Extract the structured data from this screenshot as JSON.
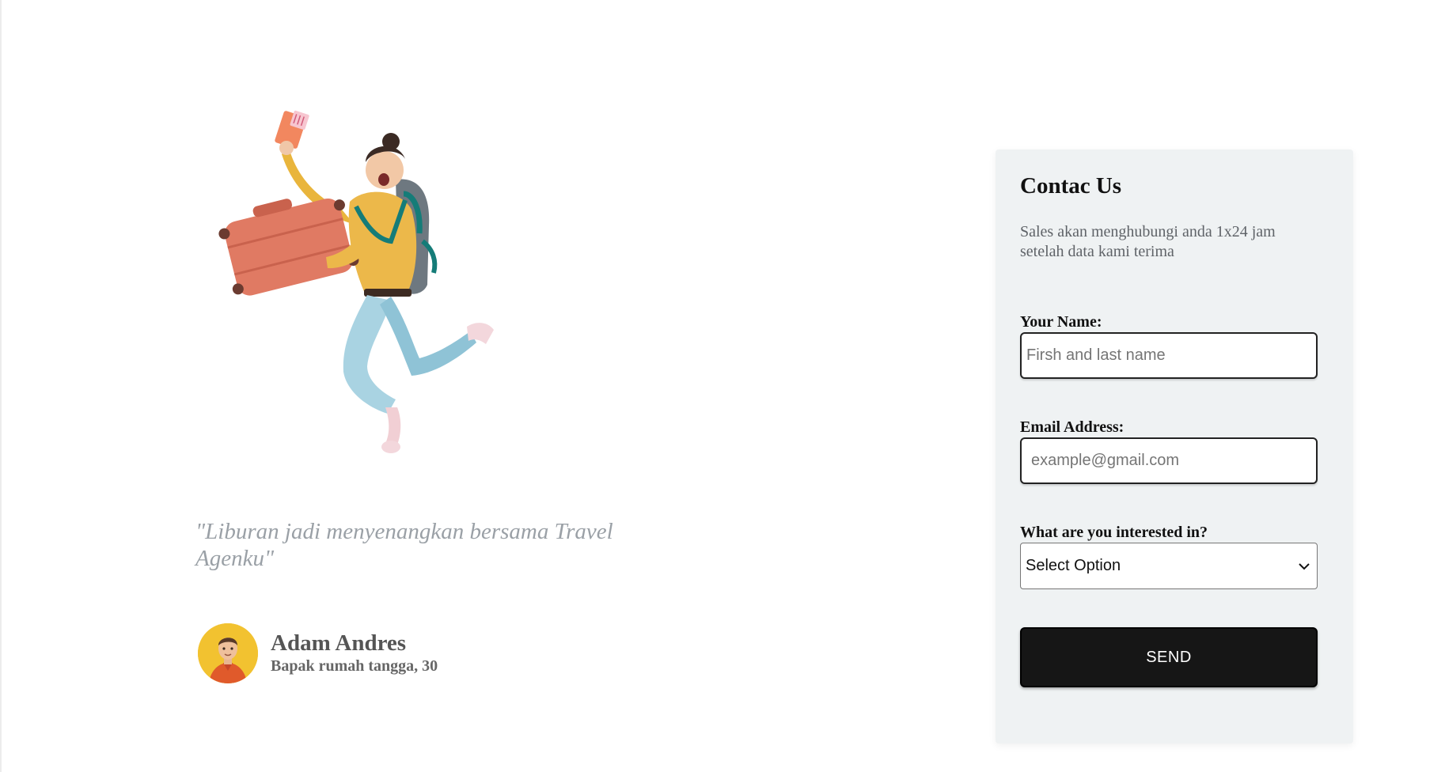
{
  "hero": {
    "illustration_icon": "jumping-traveler-illustration",
    "quote": "\"Liburan jadi menyenangkan bersama Travel Agenku\""
  },
  "testimonial": {
    "avatar_icon": "avatar-portrait",
    "name": "Adam Andres",
    "role": "Bapak rumah tangga, 30"
  },
  "contact": {
    "title": "Contac Us",
    "description": "Sales akan menghubungi anda 1x24 jam setelah data kami terima",
    "name_label": "Your Name:",
    "name_placeholder": "Firsh and last name",
    "email_label": "Email Address:",
    "email_placeholder": "example@gmail.com",
    "interest_label": "What are you interested in?",
    "interest_selected": "Select Option",
    "send_label": "SEND"
  },
  "colors": {
    "card_bg": "#eff2f3",
    "button_bg": "#161616",
    "quote_text": "#9aa0a6",
    "avatar_bg": "#f2c230",
    "suitcase": "#e07a63"
  }
}
